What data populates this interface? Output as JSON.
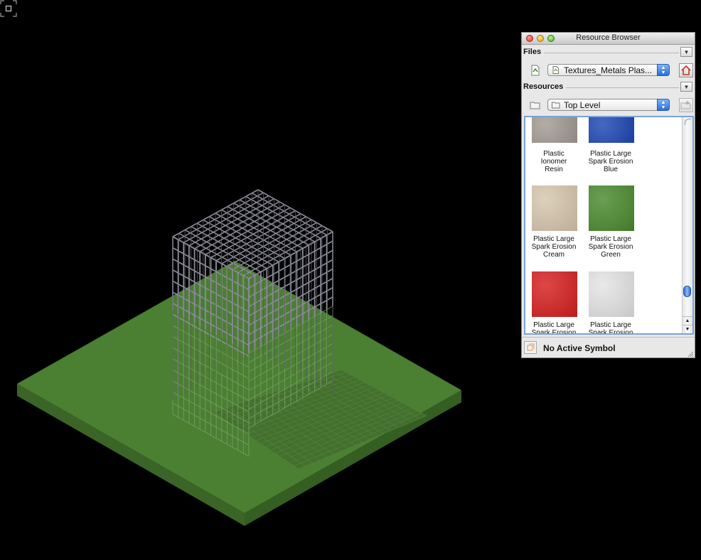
{
  "palette": {
    "title": "Resource Browser",
    "files_label": "Files",
    "file_name": "Textures_Metals Plas...",
    "resources_label": "Resources",
    "folder_name": "Top Level",
    "status": "No Active Symbol"
  },
  "resources": [
    {
      "line1": "Plastic",
      "line2": "Ionomer",
      "line3": "Resin",
      "color": "#a39b93"
    },
    {
      "line1": "Plastic Large",
      "line2": "Spark Erosion",
      "line3": "Blue",
      "color": "#1d47b4"
    },
    {
      "line1": "Plastic Large",
      "line2": "Spark Erosion",
      "line3": "Cream",
      "color": "#d6c6ad"
    },
    {
      "line1": "Plastic Large",
      "line2": "Spark Erosion",
      "line3": "Green",
      "color": "#4a8a2e"
    },
    {
      "line1": "Plastic Large",
      "line2": "Spark Erosion",
      "line3": "",
      "color": "#d61f1f"
    },
    {
      "line1": "Plastic Large",
      "line2": "Spark Erosion",
      "line3": "",
      "color": "#e4e4e4"
    }
  ],
  "scene": {
    "ground_top_color": "#4b7f32",
    "ground_side_color": "#3a6526",
    "mesh_color": "#8a8a96",
    "mesh_lower_color": "#6f9a5e"
  }
}
